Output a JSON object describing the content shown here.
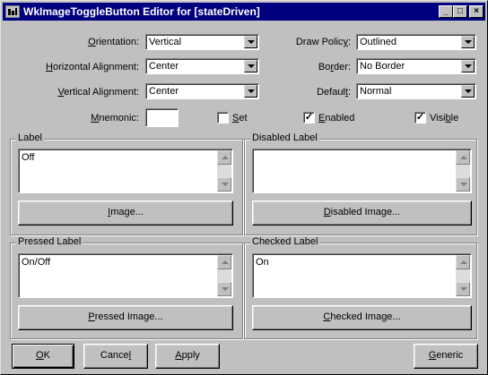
{
  "window": {
    "title": "WkImageToggleButton Editor for [stateDriven]",
    "min_glyph": "_",
    "max_glyph": "□",
    "close_glyph": "×"
  },
  "icons": {
    "app": "app-window-icon",
    "scroll_up": "arrow-up-icon",
    "scroll_down": "arrow-down-icon",
    "dropdown": "chevron-down-icon"
  },
  "fields": {
    "orientation": {
      "label_u": "O",
      "label_rest": "rientation:",
      "value": "Vertical"
    },
    "horizontal_alignment": {
      "label_u": "H",
      "label_rest": "orizontal Alignment:",
      "value": "Center"
    },
    "vertical_alignment": {
      "label_u": "V",
      "label_rest": "ertical Alignment:",
      "value": "Center"
    },
    "draw_policy": {
      "label_pre": "Draw Polic",
      "label_u": "y",
      "label_rest": ":",
      "value": "Outlined"
    },
    "border": {
      "label_pre": "Bo",
      "label_u": "r",
      "label_rest": "der:",
      "value": "No Border"
    },
    "default": {
      "label_pre": "Defaul",
      "label_u": "t",
      "label_rest": ":",
      "value": "Normal"
    },
    "mnemonic": {
      "label_u": "M",
      "label_rest": "nemonic:",
      "value": ""
    }
  },
  "checkboxes": {
    "set": {
      "label_u": "S",
      "label_rest": "et",
      "checked": false
    },
    "enabled": {
      "label_u": "E",
      "label_rest": "nabled",
      "checked": true
    },
    "visible": {
      "label_pre": "Visi",
      "label_u": "b",
      "label_rest": "le",
      "checked": true
    }
  },
  "check_glyph": "✓",
  "groups": {
    "label": {
      "title": "Label",
      "text": "Off",
      "button_u": "I",
      "button_rest": "mage..."
    },
    "disabled_label": {
      "title": "Disabled Label",
      "text": "",
      "button_u": "D",
      "button_rest": "isabled Image..."
    },
    "pressed_label": {
      "title": "Pressed Label",
      "text": "On/Off",
      "button_u": "P",
      "button_rest": "ressed Image..."
    },
    "checked_label": {
      "title": "Checked Label",
      "text": "On",
      "button_u": "C",
      "button_rest": "hecked Image..."
    }
  },
  "buttons": {
    "ok": {
      "u": "O",
      "rest": "K"
    },
    "cancel": {
      "pre": "Cance",
      "u": "l",
      "rest": ""
    },
    "apply": {
      "u": "A",
      "rest": "pply"
    },
    "generic": {
      "u": "G",
      "rest": "eneric"
    }
  }
}
